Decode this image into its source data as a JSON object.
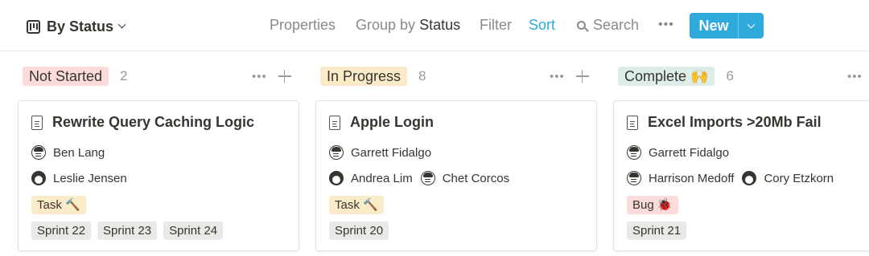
{
  "view": {
    "title": "By Status"
  },
  "toolbar": {
    "properties": "Properties",
    "group_by_label": "Group by",
    "group_by_value": "Status",
    "filter": "Filter",
    "sort": "Sort",
    "search": "Search",
    "more": "•••",
    "new": "New"
  },
  "colors": {
    "accent": "#2eaadc",
    "not_started": "#fbdcda",
    "in_progress": "#fbecc9",
    "complete": "#ddedea",
    "sprint": "#e9e9e7"
  },
  "columns": [
    {
      "name": "Not Started",
      "count": "2",
      "actions": "•••",
      "card": {
        "title": "Rewrite Query Caching Logic",
        "people_row1": [
          "Ben Lang"
        ],
        "people_row2": [
          "Leslie Jensen"
        ],
        "tag": "Task 🔨",
        "sprints": [
          "Sprint 22",
          "Sprint 23",
          "Sprint 24"
        ]
      }
    },
    {
      "name": "In Progress",
      "count": "8",
      "actions": "•••",
      "card": {
        "title": "Apple Login",
        "people_row1": [
          "Garrett Fidalgo"
        ],
        "people_row2": [
          "Andrea Lim",
          "Chet Corcos"
        ],
        "tag": "Task 🔨",
        "sprints": [
          "Sprint 20"
        ]
      }
    },
    {
      "name": "Complete 🙌",
      "count": "6",
      "actions": "•••",
      "card": {
        "title": "Excel Imports >20Mb Fail",
        "people_row1": [
          "Garrett Fidalgo"
        ],
        "people_row2": [
          "Harrison Medoff",
          "Cory Etzkorn"
        ],
        "tag": "Bug 🐞",
        "sprints": [
          "Sprint 21"
        ]
      }
    }
  ]
}
